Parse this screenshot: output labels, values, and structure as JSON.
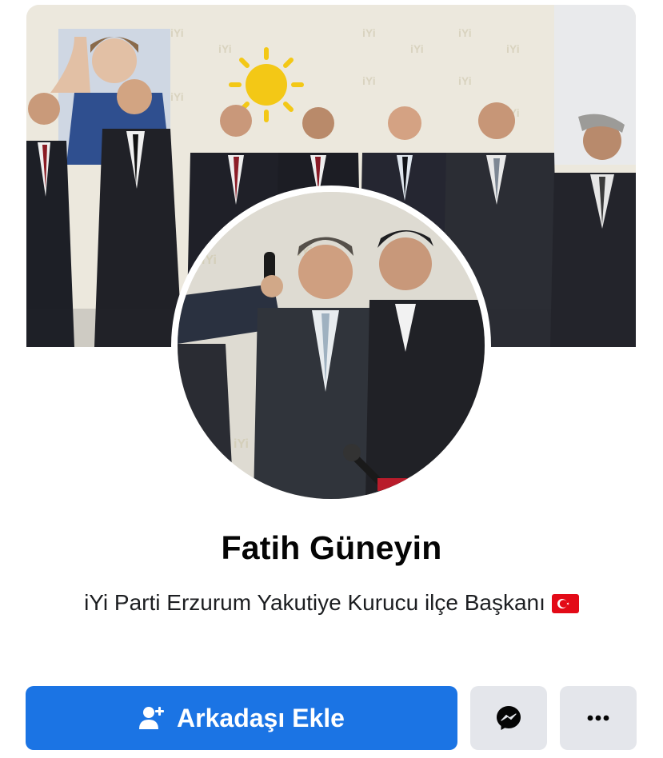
{
  "profile": {
    "name": "Fatih Güneyin",
    "bio": "iYi Parti Erzurum Yakutiye Kurucu ilçe Başkanı",
    "bio_emoji": "turkey-flag-icon"
  },
  "actions": {
    "add_friend_label": "Arkadaşı Ekle",
    "add_friend_icon": "add-friend-icon",
    "message_icon": "messenger-icon",
    "more_icon": "more-dots-icon"
  },
  "images": {
    "cover_photo": "group-photo-party-event",
    "cover_backdrop_text": "iYi",
    "profile_photo": "two-men-with-microphones"
  },
  "colors": {
    "primary_button": "#1b74e4",
    "secondary_button": "#e4e6eb",
    "text": "#050505"
  }
}
